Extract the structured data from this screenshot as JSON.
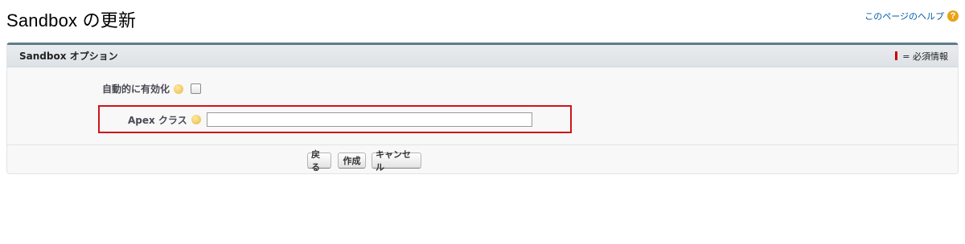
{
  "page": {
    "title": "Sandbox の更新",
    "help_link_label": "このページのヘルプ",
    "help_icon": "question-circle-icon"
  },
  "panel": {
    "title": "Sandbox オプション",
    "required_legend": "= 必須情報",
    "required_color": "#cc0000"
  },
  "fields": {
    "auto_activate": {
      "label": "自動的に有効化",
      "checked": false
    },
    "apex_class": {
      "label": "Apex クラス",
      "value": "",
      "highlight_color": "#d0141b"
    }
  },
  "buttons": {
    "back": "戻る",
    "create": "作成",
    "cancel": "キャンセル"
  }
}
